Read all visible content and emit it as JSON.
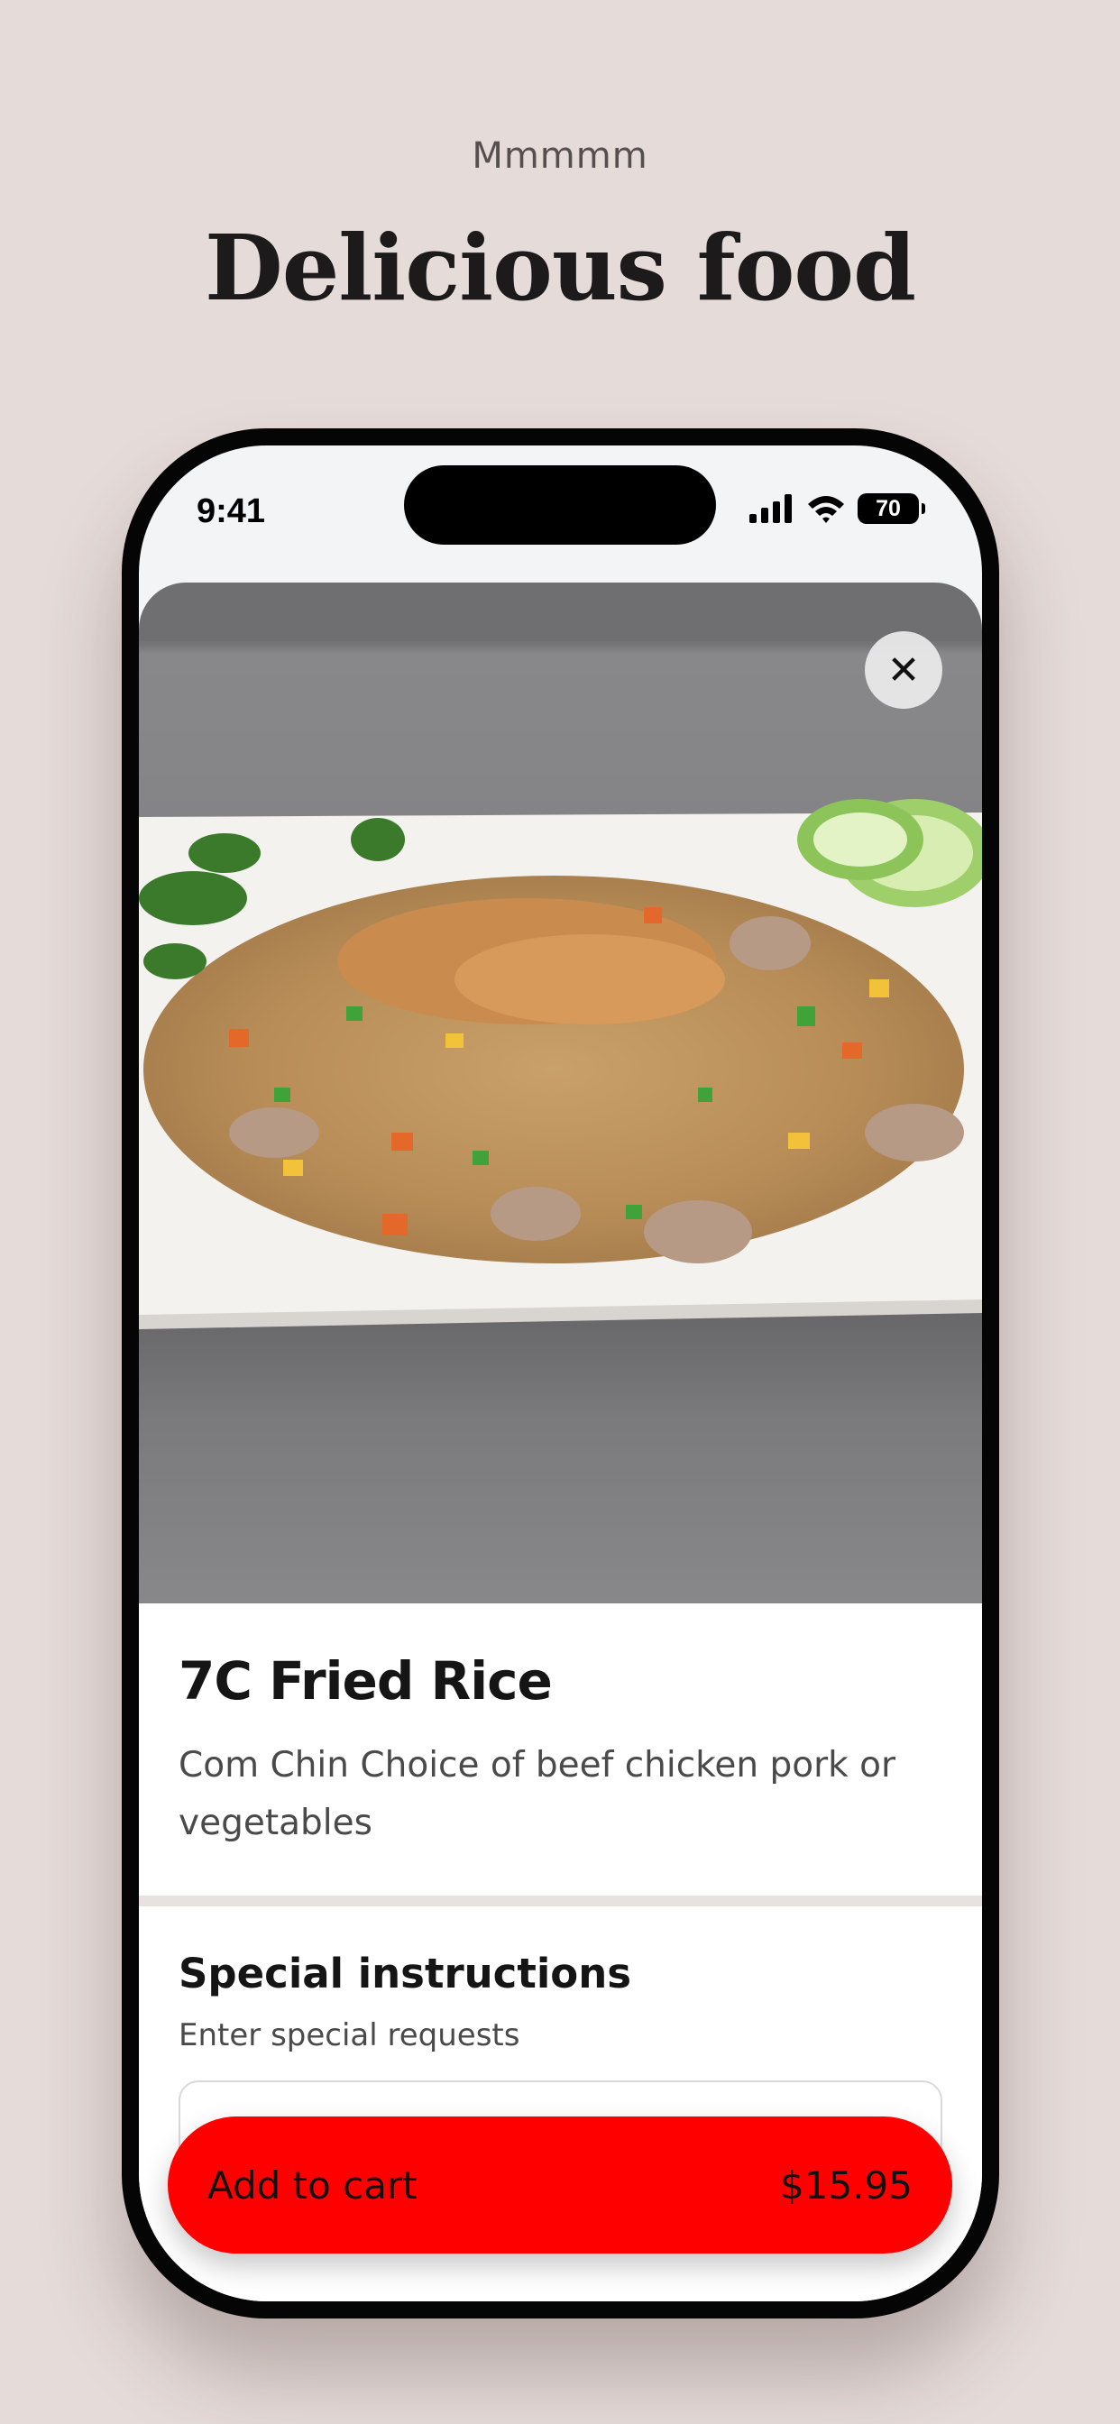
{
  "page": {
    "eyebrow": "Mmmmm",
    "headline": "Delicious food"
  },
  "status_bar": {
    "time": "9:41",
    "battery": "70"
  },
  "item": {
    "close_icon": "close-icon",
    "title": "7C Fried Rice",
    "description": "Com Chin Choice of beef chicken pork or vegetables"
  },
  "special_instructions": {
    "title": "Special instructions",
    "subtitle": "Enter special requests",
    "value": "",
    "placeholder": ""
  },
  "cart": {
    "label": "Add to cart",
    "price": "$15.95"
  },
  "colors": {
    "background": "#e5dbd9",
    "accent": "#ff0000"
  }
}
